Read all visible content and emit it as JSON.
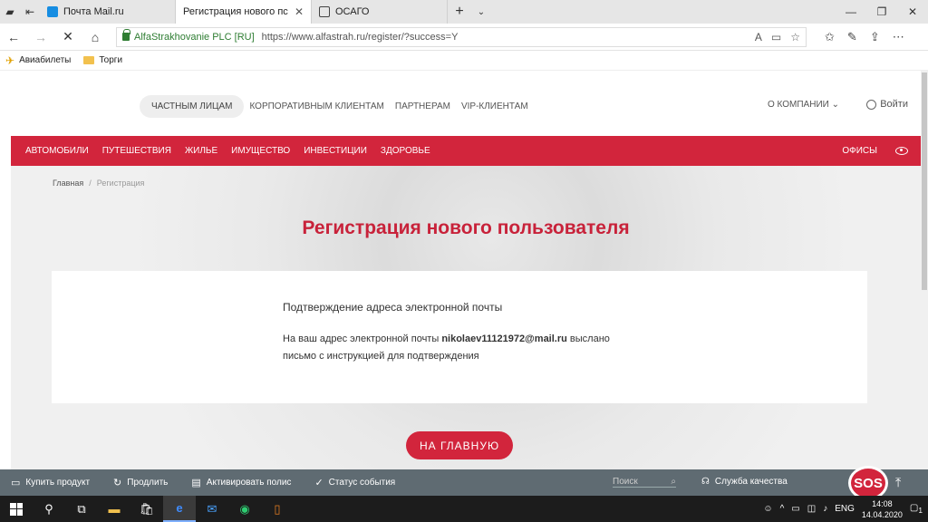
{
  "browser": {
    "tabs": [
      {
        "label": "Почта Mail.ru",
        "active": false
      },
      {
        "label": "Регистрация нового пс",
        "active": true
      },
      {
        "label": "ОСАГО",
        "active": false
      }
    ],
    "cert_label": "AlfaStrakhovanie PLC [RU]",
    "url": "https://www.alfastrah.ru/register/?success=Y",
    "bookmarks": [
      "Авиабилеты",
      "Торги"
    ]
  },
  "site": {
    "top_nav": [
      "ЧАСТНЫМ ЛИЦАМ",
      "КОРПОРАТИВНЫМ КЛИЕНТАМ",
      "ПАРТНЕРАМ",
      "VIP-КЛИЕНТАМ"
    ],
    "company_menu": "О КОМПАНИИ",
    "login": "Войти",
    "categories": [
      "АВТОМОБИЛИ",
      "ПУТЕШЕСТВИЯ",
      "ЖИЛЬЕ",
      "ИМУЩЕСТВО",
      "ИНВЕСТИЦИИ",
      "ЗДОРОВЬЕ"
    ],
    "offices": "ОФИСЫ",
    "breadcrumb": {
      "home": "Главная",
      "current": "Регистрация"
    },
    "page_title": "Регистрация нового пользователя",
    "card": {
      "title": "Подтверждение адреса электронной почты",
      "text_before": "На ваш адрес электронной почты ",
      "email": "nikolaev11121972@mail.ru",
      "text_after": " выслано письмо с инструкцией для подтверждения"
    },
    "main_button": "НА ГЛАВНУЮ",
    "accent_color": "#d2253c"
  },
  "bottom_bar": {
    "items": [
      "Купить продукт",
      "Продлить",
      "Активировать полис",
      "Статус события"
    ],
    "search_placeholder": "Поиск",
    "quality": "Служба качества",
    "sos": "SOS"
  },
  "taskbar": {
    "language": "ENG",
    "time": "14:08",
    "date": "14.04.2020",
    "notification_count": "1"
  }
}
